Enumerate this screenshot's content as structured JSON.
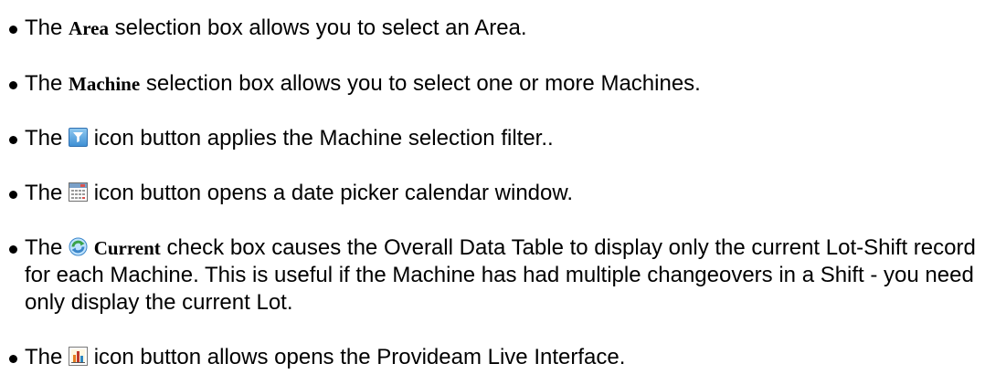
{
  "items": [
    {
      "pre": "The ",
      "term": "Area",
      "post": " selection box allows you to select an Area."
    },
    {
      "pre": "The ",
      "term": "Machine",
      "post": " selection box allows you to select one or more Machines."
    },
    {
      "pre": "The ",
      "icon": "filter-icon",
      "post": " icon button applies the Machine selection filter.."
    },
    {
      "pre": "The ",
      "icon": "calendar-icon",
      "post": " icon button opens a date picker calendar window."
    },
    {
      "pre": "The ",
      "icon": "refresh-current-icon",
      "term": "Current",
      "post": " check box causes the Overall Data Table to display only the current Lot-Shift record for each Machine. This is useful if the Machine has had multiple changeovers in a Shift - you need only display the current Lot."
    },
    {
      "pre": "The ",
      "icon": "bar-chart-icon",
      "post": " icon button allows opens the Provideam Live Interface."
    }
  ],
  "colors": {
    "text": "#000000",
    "filter_icon": "#3f8fd4",
    "calendar_header": "#d9534f",
    "current_icon": "#3aa34a",
    "chart_bar": "#c0392b"
  }
}
